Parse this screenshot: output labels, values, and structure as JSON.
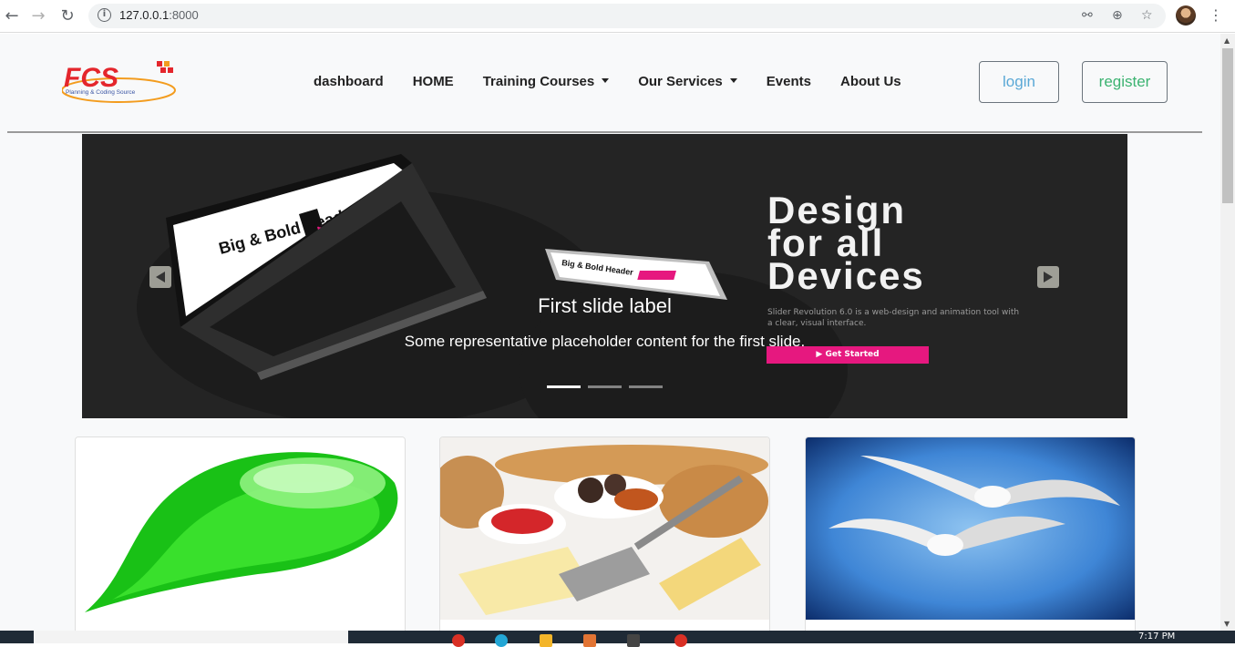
{
  "browser": {
    "url_host": "127.0.0.1",
    "url_port": ":8000",
    "icons": [
      "back-icon",
      "forward-icon",
      "reload-icon",
      "info-icon",
      "key-icon",
      "zoom-icon",
      "star-icon",
      "avatar",
      "menu-icon"
    ]
  },
  "navbar": {
    "brand": "FCS",
    "brand_tagline": "Planning & Coding Source",
    "links": [
      {
        "label": "dashboard",
        "dropdown": false
      },
      {
        "label": "HOME",
        "dropdown": false
      },
      {
        "label": "Training Courses",
        "dropdown": true
      },
      {
        "label": "Our Services",
        "dropdown": true
      },
      {
        "label": "Events",
        "dropdown": false
      },
      {
        "label": "About Us",
        "dropdown": false
      }
    ],
    "login_label": "login",
    "register_label": "register"
  },
  "carousel": {
    "slide_image": {
      "laptop_text": "Big & Bold Header",
      "headline_line1": "Design",
      "headline_line2": "for all",
      "headline_line3": "Devices",
      "subtext": "Slider Revolution 6.0 is a web-design and animation tool with a clear, visual interface.",
      "cta": "Get Started"
    },
    "caption_title": "First slide label",
    "caption_text": "Some representative placeholder content for the first slide.",
    "slide_count": 3,
    "active_slide": 1
  },
  "cards": [
    {
      "image": "green-droplet"
    },
    {
      "image": "cheese-crackers"
    },
    {
      "image": "seagulls-flying"
    }
  ],
  "taskbar": {
    "clock": "7:17 PM"
  },
  "colors": {
    "login": "#5aa8d6",
    "register": "#3cb371",
    "cta": "#e6187f",
    "carousel_bg": "#242424"
  }
}
